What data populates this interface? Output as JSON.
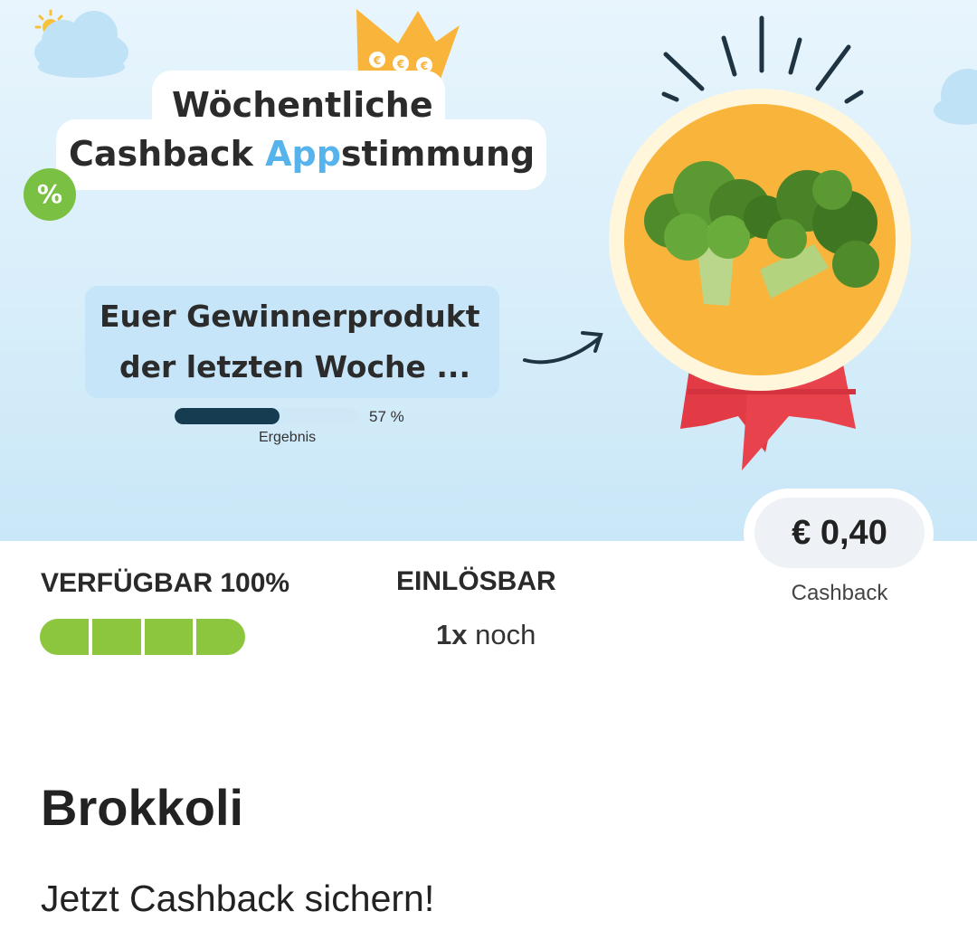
{
  "banner": {
    "title_line1": "Wöchentliche",
    "title_line2_prefix": "Cashback ",
    "title_line2_accent": "App",
    "title_line2_suffix": "stimmung",
    "percent_badge": "%",
    "crown_symbols": "€€€",
    "winner_line1": "Euer Gewinnerprodukt",
    "winner_line2": "der letzten Woche ...",
    "result_percent_text": "57 %",
    "result_fraction": 0.57,
    "result_label": "Ergebnis",
    "accent_color": "#56b3ec"
  },
  "price": {
    "amount": "€ 0,40",
    "label": "Cashback"
  },
  "stats": {
    "available_label": "VERFÜGBAR 100%",
    "available_fraction": 1.0,
    "available_segments": 4,
    "redeemable_label": "EINLÖSBAR",
    "redeemable_count": "1x",
    "redeemable_suffix": " noch"
  },
  "product": {
    "name": "Brokkoli",
    "subtitle": "Jetzt Cashback sichern!"
  },
  "colors": {
    "availability_green": "#8cc63f",
    "medal_orange": "#f9b43b",
    "ribbon_red": "#e23b45",
    "progress_dark": "#163c52"
  },
  "icons": [
    "sun-icon",
    "cloud-icon",
    "crown-icon",
    "percent-badge-icon",
    "arrow-icon",
    "medal-icon",
    "broccoli-image"
  ]
}
